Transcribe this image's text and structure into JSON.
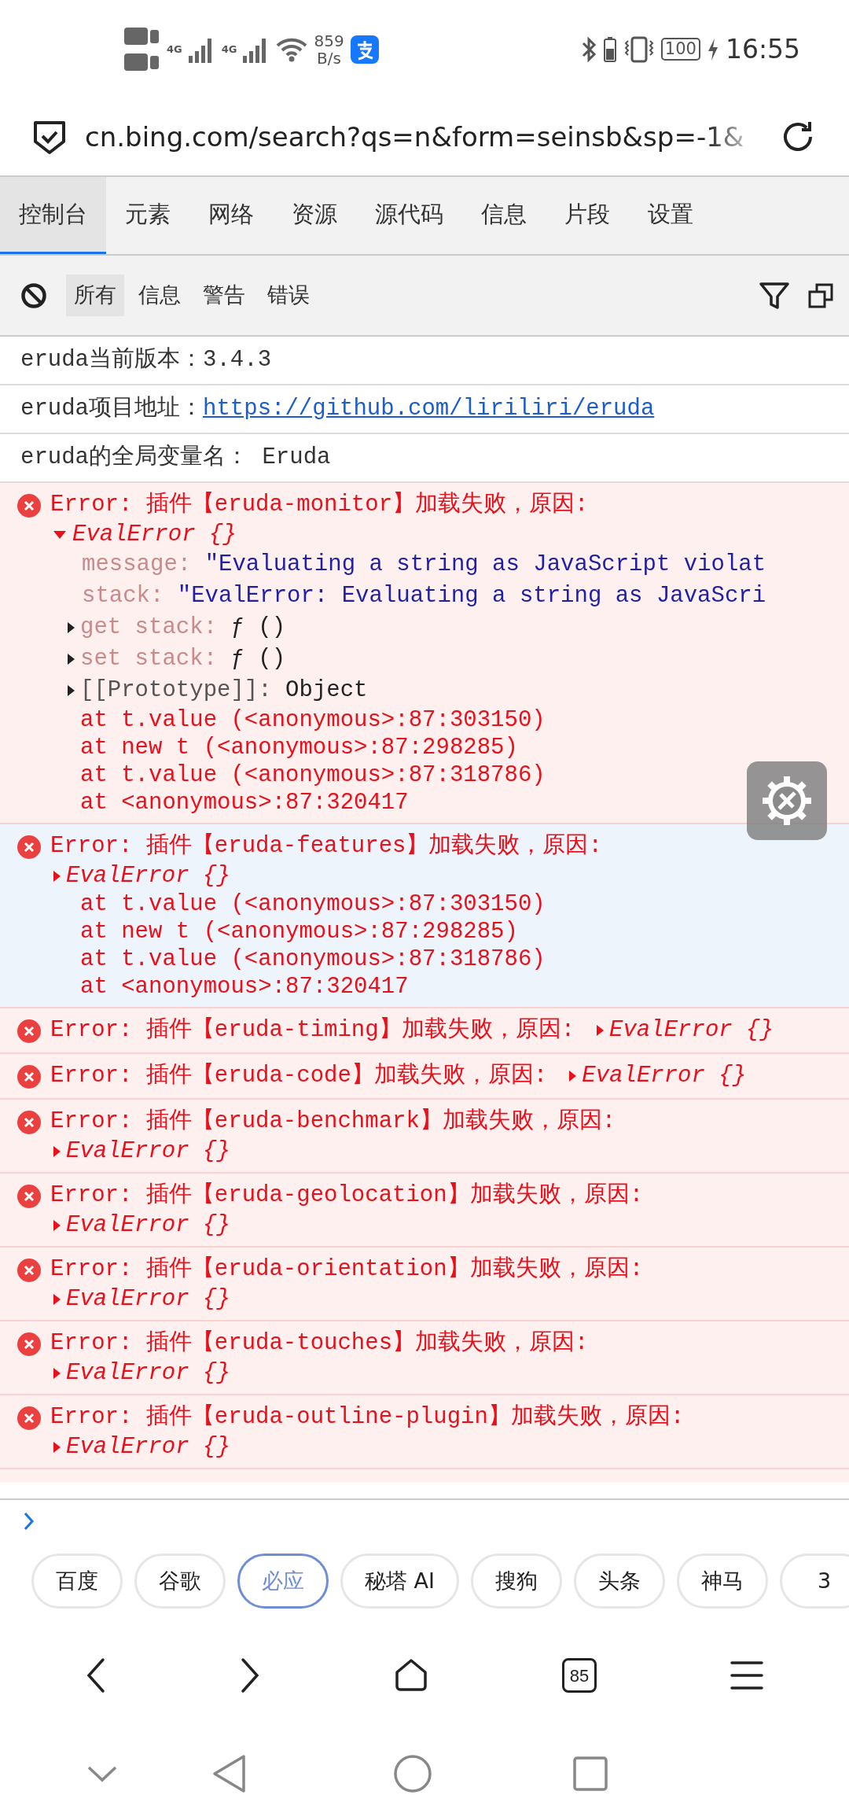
{
  "status_bar": {
    "sim_1_type": "4G",
    "sim_2_type": "4G",
    "net_speed": "859",
    "net_speed_unit": "B/s",
    "battery": "100",
    "time": "16:55"
  },
  "address_bar": {
    "url": "cn.bing.com/search?qs=n&form=seinsb&sp=-1&"
  },
  "devtools_tabs": [
    {
      "label": "控制台",
      "selected": true
    },
    {
      "label": "元素",
      "selected": false
    },
    {
      "label": "网络",
      "selected": false
    },
    {
      "label": "资源",
      "selected": false
    },
    {
      "label": "源代码",
      "selected": false
    },
    {
      "label": "信息",
      "selected": false
    },
    {
      "label": "片段",
      "selected": false
    },
    {
      "label": "设置",
      "selected": false
    }
  ],
  "filter_tabs": [
    {
      "label": "所有",
      "selected": true
    },
    {
      "label": "信息",
      "selected": false
    },
    {
      "label": "警告",
      "selected": false
    },
    {
      "label": "错误",
      "selected": false
    }
  ],
  "logs": [
    {
      "kind": "info",
      "text": "eruda当前版本：3.4.3"
    },
    {
      "kind": "link",
      "text": "eruda项目地址：",
      "link": "https://github.com/liriliri/eruda"
    },
    {
      "kind": "info",
      "text": "eruda的全局变量名： Eruda"
    },
    {
      "kind": "error",
      "selected": false,
      "message": "Error: 插件【eruda-monitor】加载失败，原因:",
      "object": {
        "label": "EvalError {}",
        "expanded": true,
        "inline": false,
        "properties": [
          {
            "kind": "string",
            "key": "message:",
            "value": "\"Evaluating a string as JavaScript violat"
          },
          {
            "kind": "string",
            "key": "stack:",
            "value": "\"EvalError: Evaluating a string as JavaScri"
          },
          {
            "kind": "accessor",
            "key": "get stack:",
            "value": "ƒ ()"
          },
          {
            "kind": "accessor",
            "key": "set stack:",
            "value": "ƒ ()"
          },
          {
            "kind": "internal",
            "key": "[[Prototype]]:",
            "value": "Object"
          }
        ]
      },
      "stack": [
        "at t.value (<anonymous>:87:303150)",
        "at new t (<anonymous>:87:298285)",
        "at t.value (<anonymous>:87:318786)",
        "at <anonymous>:87:320417"
      ]
    },
    {
      "kind": "error",
      "selected": true,
      "message": "Error: 插件【eruda-features】加载失败，原因:",
      "object": {
        "label": "EvalError {}",
        "expanded": false,
        "inline": false
      },
      "stack": [
        "at t.value (<anonymous>:87:303150)",
        "at new t (<anonymous>:87:298285)",
        "at t.value (<anonymous>:87:318786)",
        "at <anonymous>:87:320417"
      ]
    },
    {
      "kind": "error",
      "selected": false,
      "message": "Error: 插件【eruda-timing】加载失败，原因:",
      "object": {
        "label": "EvalError {}",
        "expanded": false,
        "inline": true
      }
    },
    {
      "kind": "error",
      "selected": false,
      "message": "Error: 插件【eruda-code】加载失败，原因:",
      "object": {
        "label": "EvalError {}",
        "expanded": false,
        "inline": true
      }
    },
    {
      "kind": "error",
      "selected": false,
      "message": "Error: 插件【eruda-benchmark】加载失败，原因:",
      "object": {
        "label": "EvalError {}",
        "expanded": false,
        "inline": false
      }
    },
    {
      "kind": "error",
      "selected": false,
      "message": "Error: 插件【eruda-geolocation】加载失败，原因:",
      "object": {
        "label": "EvalError {}",
        "expanded": false,
        "inline": false
      }
    },
    {
      "kind": "error",
      "selected": false,
      "message": "Error: 插件【eruda-orientation】加载失败，原因:",
      "object": {
        "label": "EvalError {}",
        "expanded": false,
        "inline": false
      }
    },
    {
      "kind": "error",
      "selected": false,
      "message": "Error: 插件【eruda-touches】加载失败，原因:",
      "object": {
        "label": "EvalError {}",
        "expanded": false,
        "inline": false
      }
    },
    {
      "kind": "error",
      "selected": false,
      "message": "Error: 插件【eruda-outline-plugin】加载失败，原因:",
      "object": {
        "label": "EvalError {}",
        "expanded": false,
        "inline": false
      }
    }
  ],
  "search_engines": [
    {
      "label": "百度",
      "selected": false
    },
    {
      "label": "谷歌",
      "selected": false
    },
    {
      "label": "必应",
      "selected": true
    },
    {
      "label": "秘塔 AI",
      "selected": false
    },
    {
      "label": "搜狗",
      "selected": false
    },
    {
      "label": "头条",
      "selected": false
    },
    {
      "label": "神马",
      "selected": false
    },
    {
      "label": "3",
      "selected": false
    }
  ],
  "browser_nav": {
    "tab_count": "85"
  }
}
